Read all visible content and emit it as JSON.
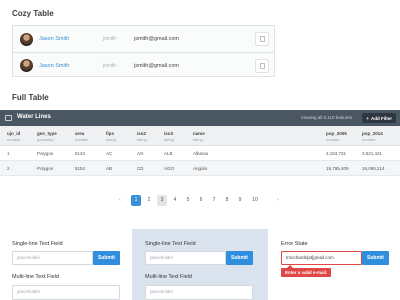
{
  "cozy": {
    "title": "Cozy Table",
    "rows": [
      {
        "name": "Jason Smith",
        "username": "jsmith",
        "email": "jsmith@gmail.com"
      },
      {
        "name": "Jason Smith",
        "username": "jsmith",
        "email": "jsmith@gmail.com"
      }
    ]
  },
  "full": {
    "title": "Full Table",
    "header": {
      "layer": "Water Lines",
      "viewing": "Viewing all 5,110 features",
      "add_filter": "Add Filter"
    },
    "columns": [
      {
        "name": "ujo_id",
        "type": "number"
      },
      {
        "name": "geo_type",
        "type": "geometry"
      },
      {
        "name": "area",
        "type": "number"
      },
      {
        "name": "fips",
        "type": "string"
      },
      {
        "name": "iso2",
        "type": "string"
      },
      {
        "name": "iso3",
        "type": "string"
      },
      {
        "name": "name",
        "type": "string"
      },
      {
        "name": "pop_2005",
        "type": "number"
      },
      {
        "name": "pop_2014",
        "type": "number"
      }
    ],
    "rows": [
      [
        "1",
        "Polygon",
        "5134",
        "AC",
        "AG",
        "ALB",
        "Albania",
        "3,153,731",
        "3,521,431"
      ],
      [
        "2",
        "Polygon",
        "5154",
        "AB",
        "CD",
        "AGO",
        "Angola",
        "15,795,409",
        "16,095,214"
      ]
    ]
  },
  "pagination": {
    "prev": "‹",
    "next": "›",
    "pages": [
      "1",
      "2",
      "3",
      "4",
      "5",
      "6",
      "7",
      "8",
      "9",
      "10"
    ],
    "current": "1"
  },
  "forms": {
    "col1": {
      "single_label": "Single-line Text Field",
      "single_placeholder": "placeholder",
      "submit": "Submit",
      "multi_label": "Multi-line Text Field",
      "multi_placeholder": "placeholder"
    },
    "col2": {
      "single_label": "Single-line Text Field",
      "single_placeholder": "placeholder",
      "submit": "Submit",
      "multi_label": "Multi-line Text Field",
      "multi_placeholder": "placeholder"
    },
    "col3": {
      "label": "Error State",
      "value": "tmrichards[at]gmail.com",
      "submit": "Submit",
      "error": "Enter a valid e-mail."
    }
  }
}
